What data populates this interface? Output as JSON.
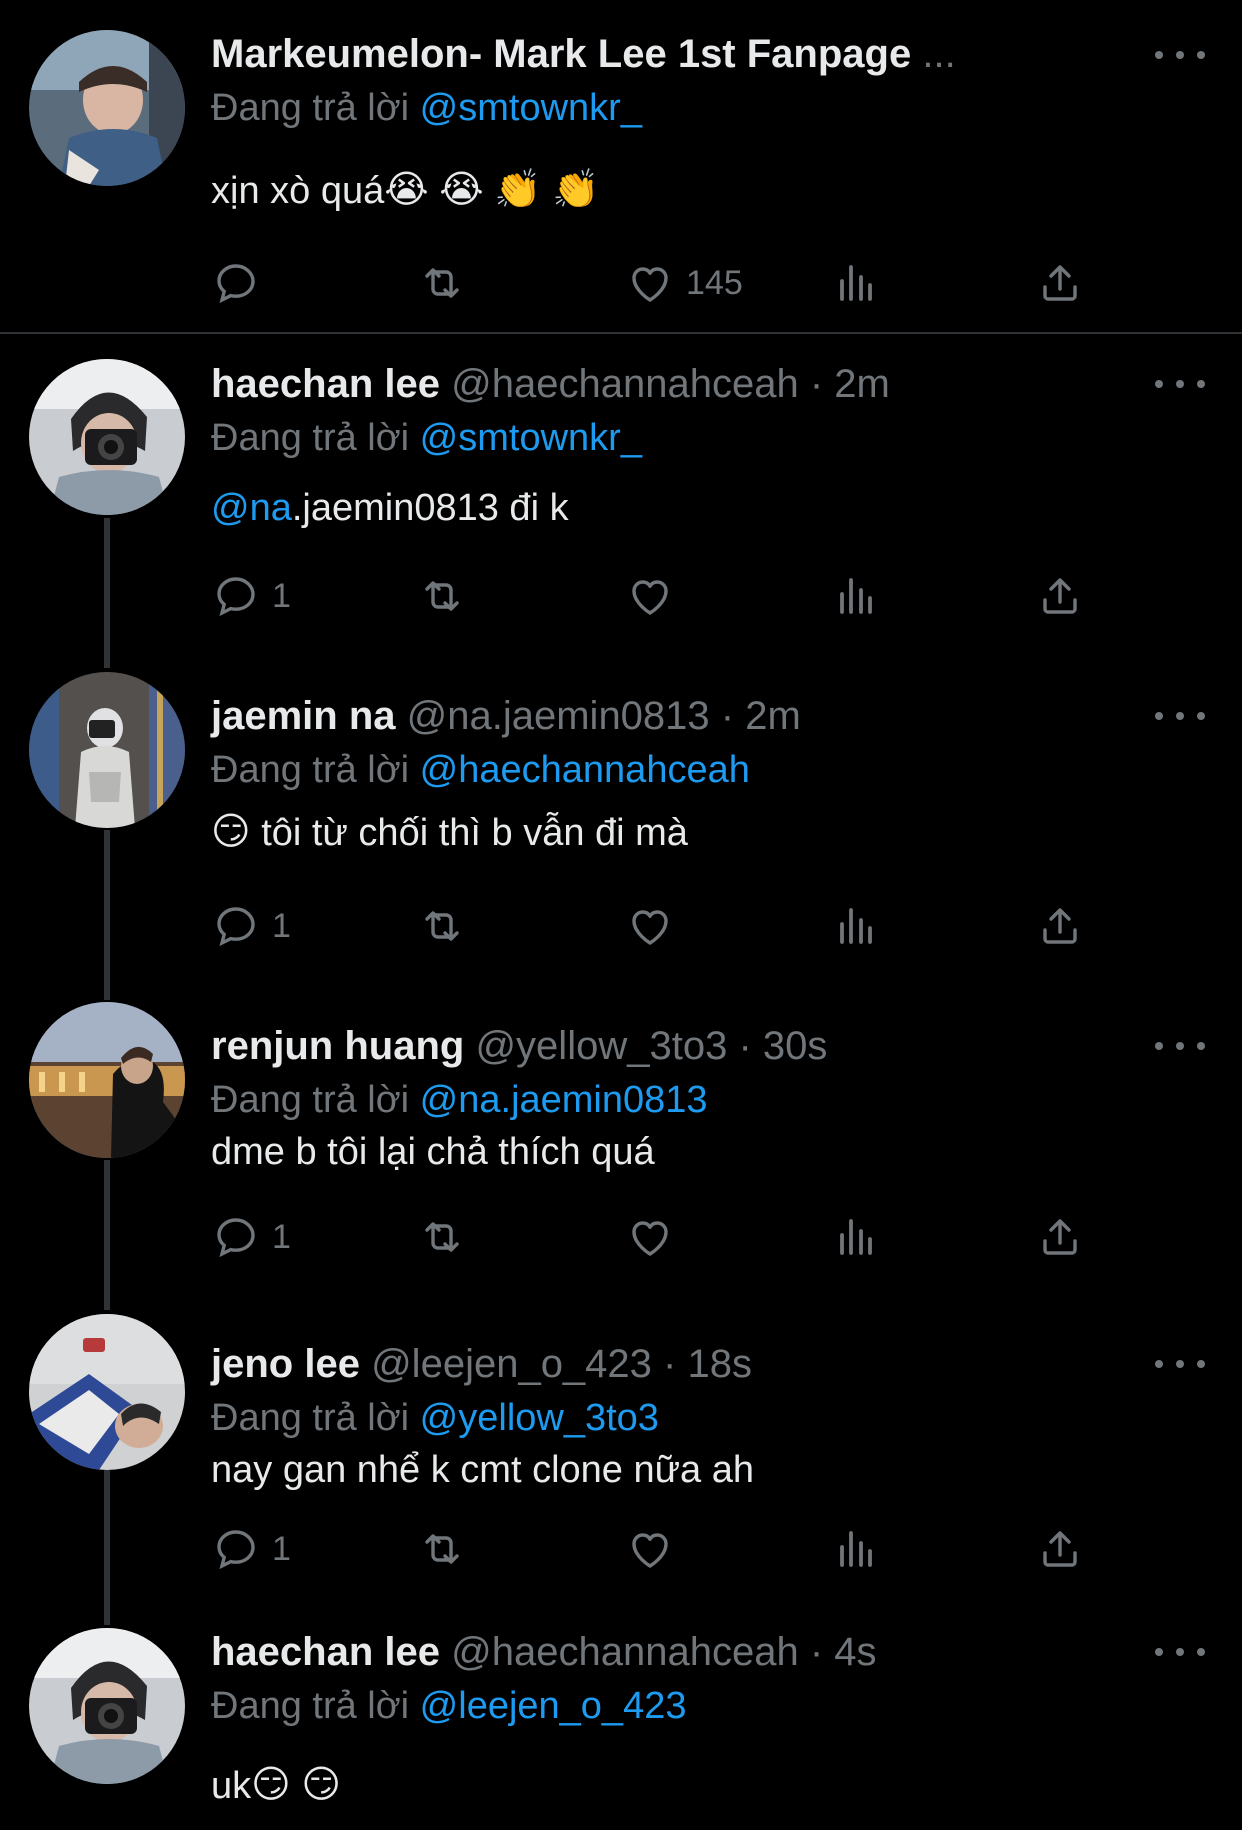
{
  "reply_label": "Đang trả lời",
  "colors": {
    "background": "#000000",
    "text": "#e7e9ea",
    "secondary": "#71767b",
    "link": "#1d9bf0",
    "divider": "#2f3336"
  },
  "icons": {
    "reply": "reply-bubble-icon",
    "retweet": "retweet-icon",
    "like": "heart-icon",
    "views": "bar-chart-icon",
    "share": "share-icon",
    "more": "more-dots-icon"
  },
  "tweets": [
    {
      "name": "Markeumelon- Mark Lee 1st Fanpage",
      "name_ellipsis": "...",
      "handle": "",
      "time": "",
      "reply_to": "@smtownkr_",
      "text": "xịn xò quá",
      "emojis": [
        "😭",
        "😭",
        "👏",
        "👏"
      ],
      "reply_count": "",
      "like_count": "145"
    },
    {
      "name": "haechan lee",
      "handle": "@haechannahceah",
      "time": "2m",
      "reply_to": "@smtownkr_",
      "mention_prefix": "@na",
      "text": ".jaemin0813 đi k",
      "reply_count": "1",
      "like_count": ""
    },
    {
      "name": "jaemin na",
      "handle": "@na.jaemin0813",
      "time": "2m",
      "reply_to": "@haechannahceah",
      "lead_emoji": "😏",
      "text": "tôi từ chối thì b vẫn đi mà",
      "reply_count": "1",
      "like_count": ""
    },
    {
      "name": "renjun huang",
      "handle": "@yellow_3to3",
      "time": "30s",
      "reply_to": "@na.jaemin0813",
      "text": "dme b tôi lại chả thích quá",
      "reply_count": "1",
      "like_count": ""
    },
    {
      "name": "jeno lee",
      "handle": "@leejen_o_423",
      "time": "18s",
      "reply_to": "@yellow_3to3",
      "text": "nay gan nhể k cmt clone nữa ah",
      "reply_count": "1",
      "like_count": ""
    },
    {
      "name": "haechan lee",
      "handle": "@haechannahceah",
      "time": "4s",
      "reply_to": "@leejen_o_423",
      "text": "uk",
      "emojis": [
        "😏",
        "😏"
      ]
    }
  ]
}
